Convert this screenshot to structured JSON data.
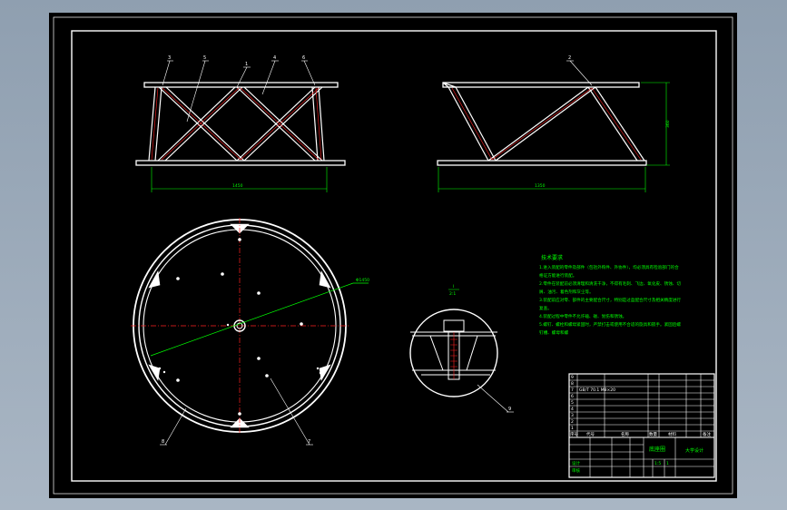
{
  "drawing": {
    "background": "#000000",
    "line_color": "#ffffff",
    "annotation_color": "#00ff00",
    "centerline_color": "#ff0000"
  },
  "front_view": {
    "part_callouts": [
      "3",
      "5",
      "1",
      "4",
      "6"
    ],
    "width_dimension": "1450"
  },
  "side_view": {
    "part_callouts": [
      "2"
    ],
    "width_dimension": "1350",
    "height_dimension": "360"
  },
  "top_view": {
    "diameter_dimension": "Φ1450",
    "part_callouts": [
      "8",
      "7"
    ]
  },
  "detail_view": {
    "label": "I",
    "scale": "2:1",
    "part_callouts": [
      "9"
    ]
  },
  "technical_requirements": {
    "title": "技术要求",
    "lines": [
      "1.进入装配的零件及部件（包括外购件、外协件），均必须具有检验部门的合",
      "格证方能进行装配。",
      "2.零件在装配前必须清理和清洗干净，不得有毛刺、飞边、氧化皮、锈蚀、切",
      "屑、油污、着色剂和灰尘等。",
      "3.装配前应对零、部件的主要配合尺寸，特别是过盈配合尺寸及相关精度进行",
      "复查。",
      "4.装配过程中零件不允许磕、碰、划伤和锈蚀。",
      "5.螺钉、螺栓和螺母紧固时，严禁打击或使用不合适的旋具和扳手。紧固后螺",
      "钉槽、螺母和螺"
    ]
  },
  "title_block": {
    "part_rows": [
      {
        "no": "9",
        "code": "",
        "name": "",
        "qty": ""
      },
      {
        "no": "8",
        "code": "",
        "name": "",
        "qty": ""
      },
      {
        "no": "7",
        "code": "GB/T 70.1 M8×20",
        "name": "",
        "qty": ""
      },
      {
        "no": "6",
        "code": "",
        "name": "",
        "qty": ""
      },
      {
        "no": "5",
        "code": "",
        "name": "",
        "qty": ""
      },
      {
        "no": "4",
        "code": "",
        "name": "",
        "qty": ""
      },
      {
        "no": "3",
        "code": "",
        "name": "",
        "qty": ""
      },
      {
        "no": "2",
        "code": "",
        "name": "",
        "qty": ""
      },
      {
        "no": "1",
        "code": "",
        "name": "",
        "qty": ""
      }
    ],
    "header": {
      "no": "序号",
      "code": "代号",
      "name": "名称",
      "qty": "数量",
      "material": "材料",
      "remark": "备注"
    },
    "drawing_name": "底座圈",
    "designer": "设计",
    "checker": "审核",
    "scale": "1:5",
    "sheet": "1",
    "company": "大学设计"
  }
}
